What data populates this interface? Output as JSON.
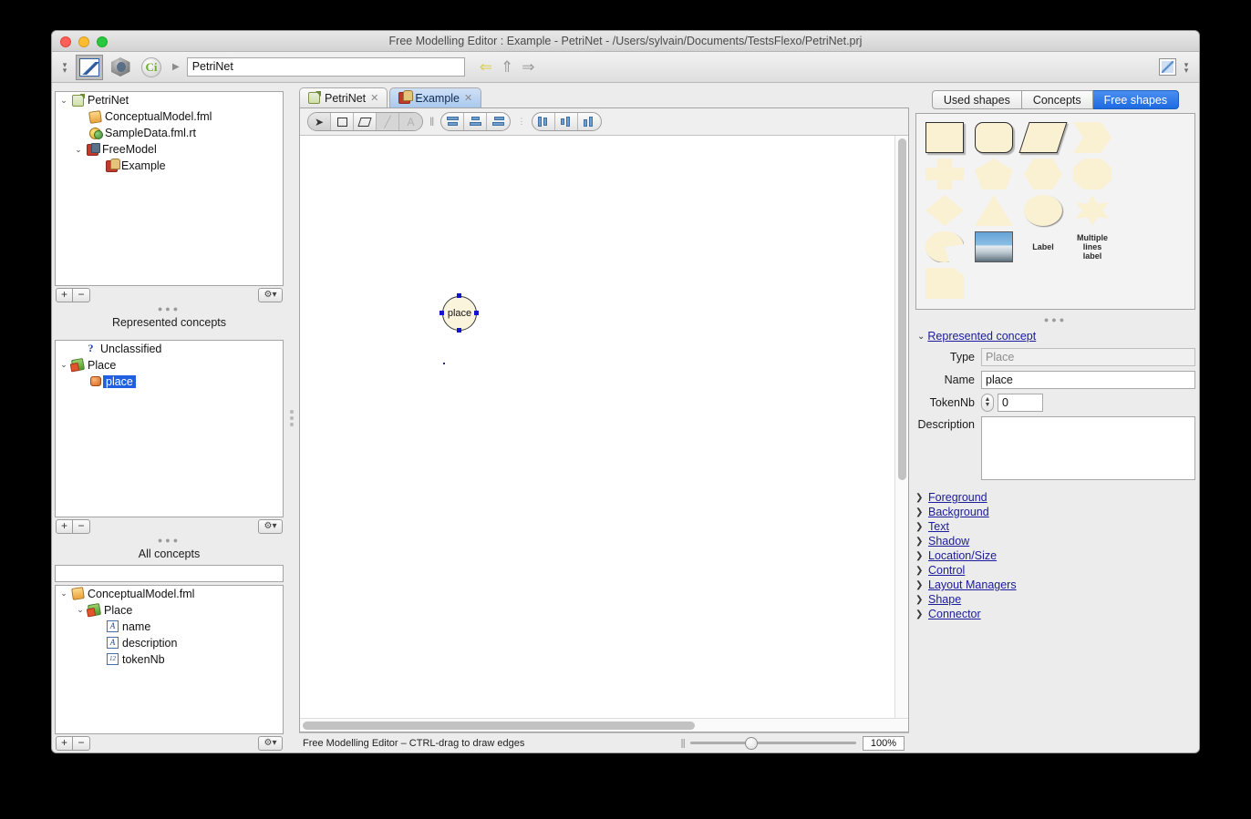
{
  "window": {
    "title": "Free Modelling Editor : Example - PetriNet - /Users/sylvain/Documents/TestsFlexo/PetriNet.prj"
  },
  "toolbar": {
    "icons": [
      "chevron-double-down",
      "openflexo-icon",
      "cube-icon",
      "ci-icon"
    ],
    "path_value": "PetriNet",
    "nav_back": "⇐",
    "nav_up": "⇑",
    "nav_forward": "⇒",
    "right_icon": "edit-square-icon",
    "right_chevrons": "chevron-double-down"
  },
  "project_tree": {
    "items": [
      {
        "label": "PetriNet",
        "icon": "project-icon",
        "twist": "⌄",
        "indent": 0
      },
      {
        "label": "ConceptualModel.fml",
        "icon": "fml-icon",
        "twist": "",
        "indent": 1
      },
      {
        "label": "SampleData.fml.rt",
        "icon": "runtime-icon",
        "twist": "",
        "indent": 1
      },
      {
        "label": "FreeModel",
        "icon": "freemodel-icon",
        "twist": "⌄",
        "indent": 1
      },
      {
        "label": "Example",
        "icon": "example-icon",
        "twist": "",
        "indent": 2
      }
    ],
    "add_label": "+",
    "remove_label": "−",
    "gear_label": "⚙▾"
  },
  "represented_concepts": {
    "title": "Represented concepts",
    "items": [
      {
        "label": "Unclassified",
        "icon": "question-icon",
        "twist": "",
        "indent": 0,
        "selected": false
      },
      {
        "label": "Place",
        "icon": "concept-icon",
        "twist": "⌄",
        "indent": 0,
        "selected": false
      },
      {
        "label": "place",
        "icon": "instance-icon",
        "twist": "",
        "indent": 1,
        "selected": true
      }
    ],
    "add_label": "+",
    "remove_label": "−",
    "gear_label": "⚙▾"
  },
  "all_concepts": {
    "title": "All concepts",
    "search_value": "",
    "search_placeholder": "",
    "items": [
      {
        "label": "ConceptualModel.fml",
        "icon": "fml-icon",
        "twist": "⌄",
        "indent": 0
      },
      {
        "label": "Place",
        "icon": "concept-icon",
        "twist": "⌄",
        "indent": 1
      },
      {
        "label": "name",
        "icon": "string-attribute-icon",
        "icon_text": "A",
        "twist": "",
        "indent": 2
      },
      {
        "label": "description",
        "icon": "string-attribute-icon",
        "icon_text": "A",
        "twist": "",
        "indent": 2
      },
      {
        "label": "tokenNb",
        "icon": "number-attribute-icon",
        "icon_text": "12",
        "twist": "",
        "indent": 2
      }
    ],
    "add_label": "+",
    "remove_label": "−",
    "gear_label": "⚙▾"
  },
  "editor": {
    "tabs": [
      {
        "label": "PetriNet",
        "icon": "project-icon",
        "active": false,
        "close": "✕"
      },
      {
        "label": "Example",
        "icon": "example-icon",
        "active": true,
        "close": "✕"
      }
    ],
    "tools": [
      {
        "name": "select-tool",
        "glyph": "➤",
        "state": "on"
      },
      {
        "name": "rectangle-tool",
        "glyph": "rect",
        "state": "normal"
      },
      {
        "name": "polygon-tool",
        "glyph": "poly",
        "state": "normal"
      },
      {
        "name": "line-tool",
        "glyph": "line",
        "state": "disabled"
      },
      {
        "name": "text-tool",
        "glyph": "A",
        "state": "disabled"
      }
    ],
    "align_tools": [
      "align-top",
      "align-middle",
      "align-bottom"
    ],
    "distribute_tools": [
      "align-left",
      "align-center",
      "align-right"
    ],
    "nodes": [
      {
        "label": "place",
        "type": "place-node",
        "selected": true
      }
    ]
  },
  "statusbar": {
    "message": "Free Modelling Editor – CTRL-drag to draw edges",
    "zoom_value": "100%"
  },
  "palette": {
    "tabs": [
      {
        "label": "Used shapes",
        "active": false
      },
      {
        "label": "Concepts",
        "active": false
      },
      {
        "label": "Free shapes",
        "active": true
      }
    ],
    "shapes": [
      [
        {
          "name": "rectangle-shape",
          "kind": "rect"
        },
        {
          "name": "rounded-rectangle-shape",
          "kind": "round"
        },
        {
          "name": "parallelogram-shape",
          "kind": "par"
        },
        {
          "name": "chevron-shape",
          "kind": "chev"
        }
      ],
      [
        {
          "name": "cross-shape",
          "kind": "cross"
        },
        {
          "name": "pentagon-shape",
          "kind": "pent"
        },
        {
          "name": "hexagon-shape",
          "kind": "hex"
        },
        {
          "name": "octagon-shape",
          "kind": "oct"
        }
      ],
      [
        {
          "name": "diamond-shape",
          "kind": "diam"
        },
        {
          "name": "triangle-shape",
          "kind": "tri"
        },
        {
          "name": "ellipse-shape",
          "kind": "ell"
        },
        {
          "name": "star-shape",
          "kind": "star"
        }
      ],
      [
        {
          "name": "pie-shape",
          "kind": "pie"
        },
        {
          "name": "image-shape",
          "kind": "img"
        },
        {
          "name": "label-shape",
          "kind": "label",
          "text": "Label"
        },
        {
          "name": "multiline-label-shape",
          "kind": "label",
          "text": "Multiple\nlines label"
        }
      ],
      [
        {
          "name": "note-shape",
          "kind": "note"
        }
      ]
    ]
  },
  "inspector": {
    "header": "Represented concept",
    "header_twist": "⌄",
    "fields": {
      "type_label": "Type",
      "type_value": "Place",
      "name_label": "Name",
      "name_value": "place",
      "tokennb_label": "TokenNb",
      "tokennb_value": "0",
      "description_label": "Description",
      "description_value": ""
    },
    "sections": [
      "Foreground",
      "Background",
      "Text",
      "Shadow",
      "Location/Size",
      "Control",
      "Layout Managers",
      "Shape",
      "Connector"
    ]
  },
  "colors": {
    "accent": "#1e6ae0",
    "selection": "#1f5fe0",
    "link": "#1b1b9b",
    "shape_fill": "#faf0d2",
    "handle": "#1414d0"
  }
}
